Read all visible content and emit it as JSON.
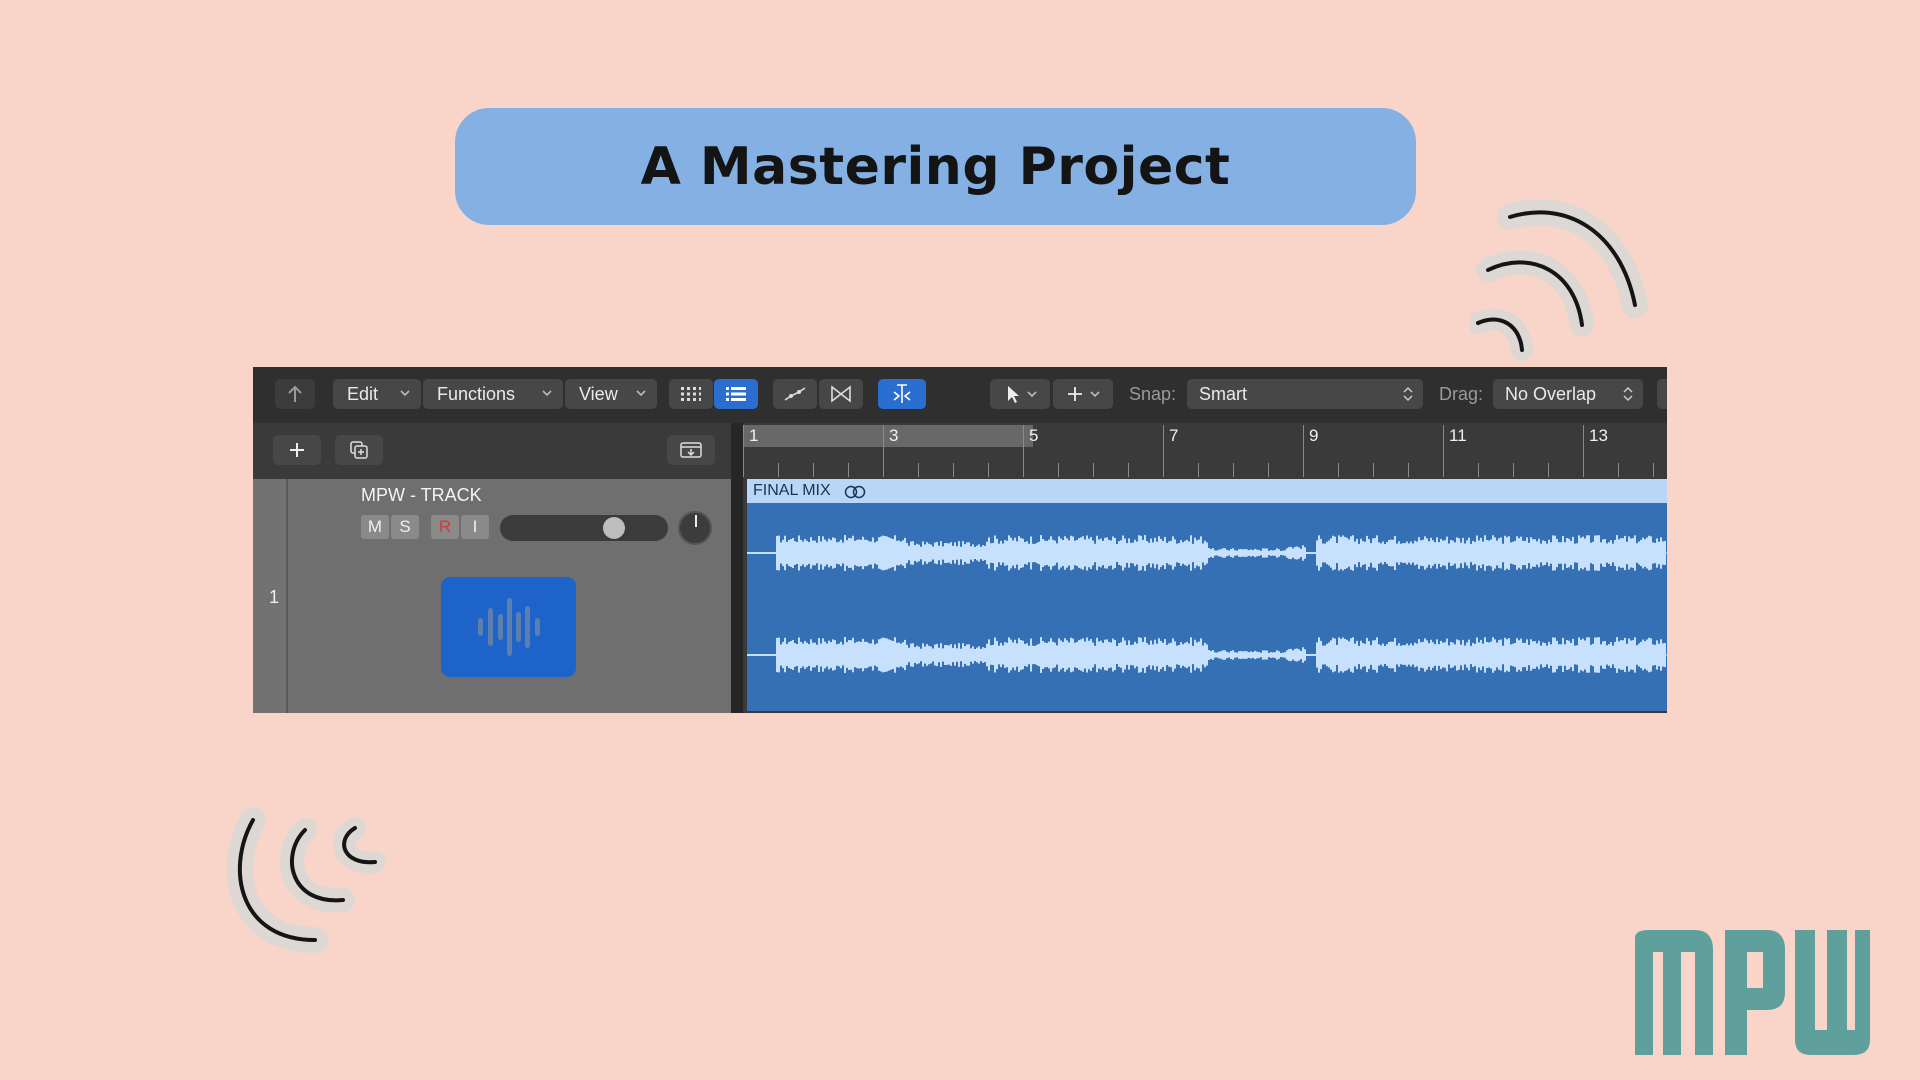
{
  "page": {
    "title": "A Mastering Project"
  },
  "toolbar": {
    "edit_label": "Edit",
    "functions_label": "Functions",
    "view_label": "View",
    "snap_label": "Snap:",
    "snap_value": "Smart",
    "drag_label": "Drag:",
    "drag_value": "No Overlap",
    "icons": [
      "back-arrow-icon",
      "grid-view-icon",
      "list-view-icon",
      "automation-icon",
      "crossfade-icon",
      "catch-playhead-icon",
      "pointer-tool-icon",
      "crosshair-tool-icon"
    ]
  },
  "track": {
    "number": "1",
    "name": "MPW - TRACK",
    "mute": "M",
    "solo": "S",
    "record": "R",
    "input": "I",
    "volume_level": 0.72,
    "colors": {
      "icon_bg": "#1e63c9",
      "record": "#d23a3a"
    }
  },
  "ruler": {
    "bars": [
      "1",
      "3",
      "5",
      "7",
      "9",
      "11",
      "13"
    ]
  },
  "region": {
    "name": "FINAL MIX",
    "colors": {
      "body": "#3470b3",
      "header": "#b9d6f6",
      "wave": "#c7e0fb"
    }
  }
}
